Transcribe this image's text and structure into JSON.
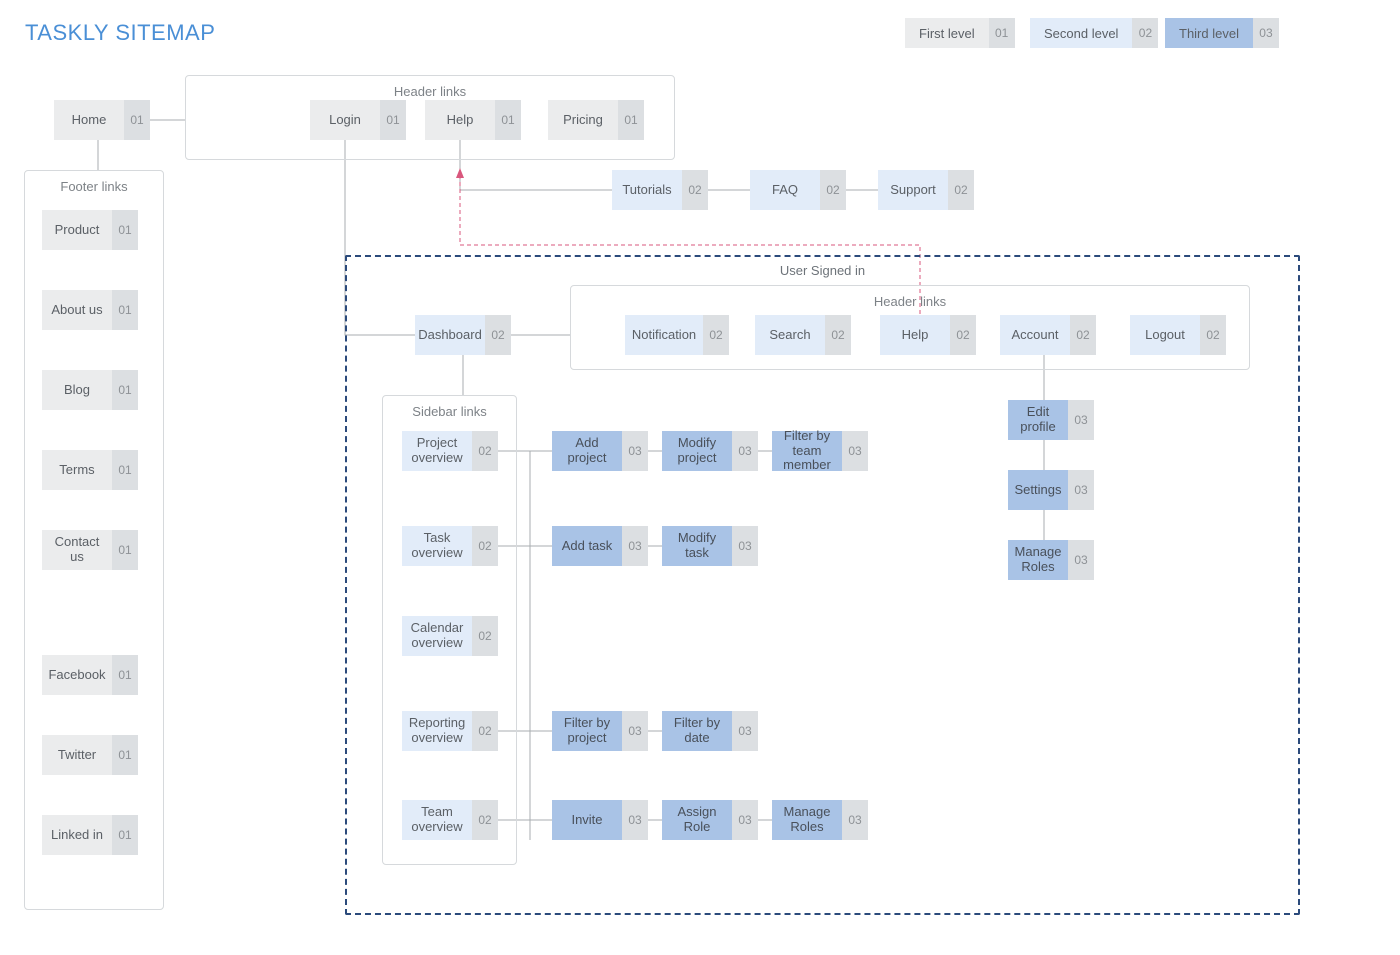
{
  "title": "TASKLY SITEMAP",
  "legend": {
    "first": {
      "label": "First level",
      "num": "01"
    },
    "second": {
      "label": "Second level",
      "num": "02"
    },
    "third": {
      "label": "Third level",
      "num": "03"
    }
  },
  "groups": {
    "footer": "Footer links",
    "header_top": "Header links",
    "signed_in": "User Signed in",
    "header_signed": "Header links",
    "sidebar": "Sidebar links"
  },
  "nodes": {
    "home": {
      "label": "Home",
      "num": "01"
    },
    "login": {
      "label": "Login",
      "num": "01"
    },
    "help_top": {
      "label": "Help",
      "num": "01"
    },
    "pricing": {
      "label": "Pricing",
      "num": "01"
    },
    "tutorials": {
      "label": "Tutorials",
      "num": "02"
    },
    "faq": {
      "label": "FAQ",
      "num": "02"
    },
    "support": {
      "label": "Support",
      "num": "02"
    },
    "product": {
      "label": "Product",
      "num": "01"
    },
    "about": {
      "label": "About us",
      "num": "01"
    },
    "blog": {
      "label": "Blog",
      "num": "01"
    },
    "terms": {
      "label": "Terms",
      "num": "01"
    },
    "contact": {
      "label": "Contact us",
      "num": "01"
    },
    "facebook": {
      "label": "Facebook",
      "num": "01"
    },
    "twitter": {
      "label": "Twitter",
      "num": "01"
    },
    "linkedin": {
      "label": "Linked in",
      "num": "01"
    },
    "dashboard": {
      "label": "Dashboard",
      "num": "02"
    },
    "notification": {
      "label": "Notification",
      "num": "02"
    },
    "search": {
      "label": "Search",
      "num": "02"
    },
    "help_signed": {
      "label": "Help",
      "num": "02"
    },
    "account": {
      "label": "Account",
      "num": "02"
    },
    "logout": {
      "label": "Logout",
      "num": "02"
    },
    "edit_profile": {
      "label": "Edit profile",
      "num": "03"
    },
    "settings": {
      "label": "Settings",
      "num": "03"
    },
    "manage_roles_acct": {
      "label": "Manage Roles",
      "num": "03"
    },
    "proj_ov": {
      "label": "Project overview",
      "num": "02"
    },
    "task_ov": {
      "label": "Task overview",
      "num": "02"
    },
    "cal_ov": {
      "label": "Calendar overview",
      "num": "02"
    },
    "rep_ov": {
      "label": "Reporting overview",
      "num": "02"
    },
    "team_ov": {
      "label": "Team overview",
      "num": "02"
    },
    "add_proj": {
      "label": "Add project",
      "num": "03"
    },
    "mod_proj": {
      "label": "Modify project",
      "num": "03"
    },
    "filter_tm": {
      "label": "Filter by team member",
      "num": "03"
    },
    "add_task": {
      "label": "Add task",
      "num": "03"
    },
    "mod_task": {
      "label": "Modify task",
      "num": "03"
    },
    "filter_proj": {
      "label": "Filter by project",
      "num": "03"
    },
    "filter_date": {
      "label": "Filter by date",
      "num": "03"
    },
    "invite": {
      "label": "Invite",
      "num": "03"
    },
    "assign_role": {
      "label": "Assign Role",
      "num": "03"
    },
    "manage_roles_team": {
      "label": "Manage Roles",
      "num": "03"
    }
  }
}
